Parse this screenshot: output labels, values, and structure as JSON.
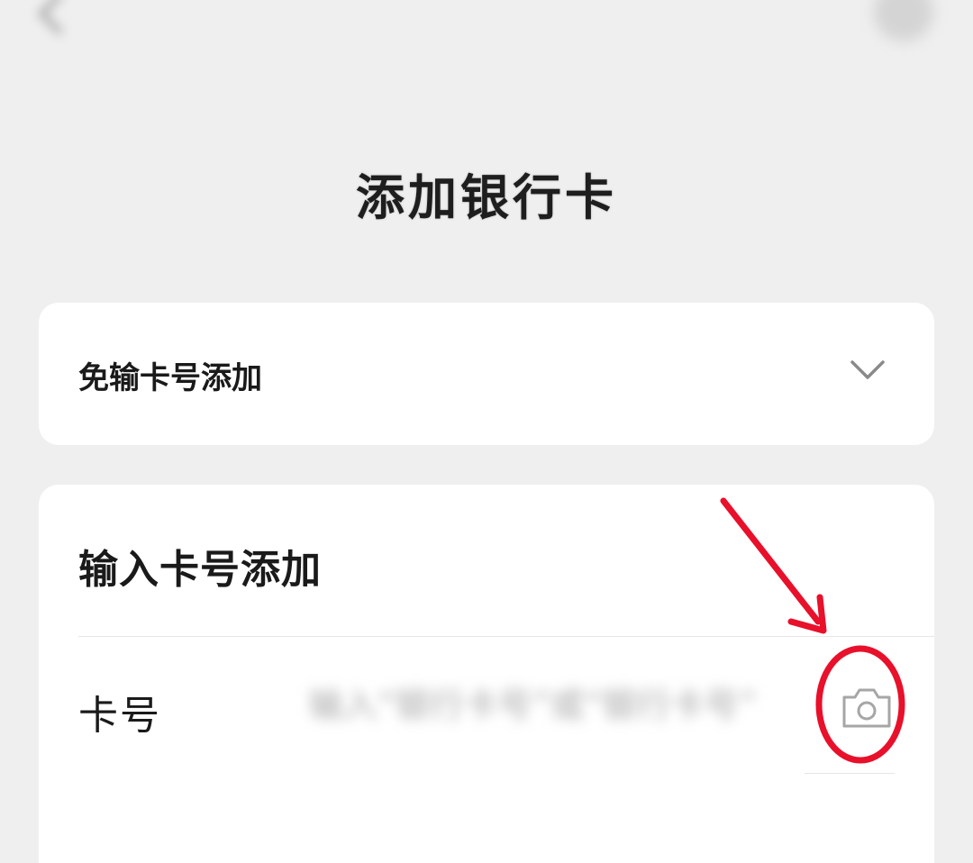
{
  "header": {
    "back_icon": "chevron-left-icon",
    "more_icon": "more-icon"
  },
  "page": {
    "title": "添加银行卡"
  },
  "quick_add": {
    "label": "免输卡号添加",
    "icon": "chevron-down-icon"
  },
  "manual_add": {
    "heading": "输入卡号添加",
    "card_number_label": "卡号",
    "card_number_placeholder": "输入“银行卡号”或“银行卡号”",
    "camera_icon": "camera-icon"
  },
  "colors": {
    "background": "#efefef",
    "card": "#ffffff",
    "annotation_red": "#e8102a",
    "icon_gray": "#a6a6a6"
  }
}
